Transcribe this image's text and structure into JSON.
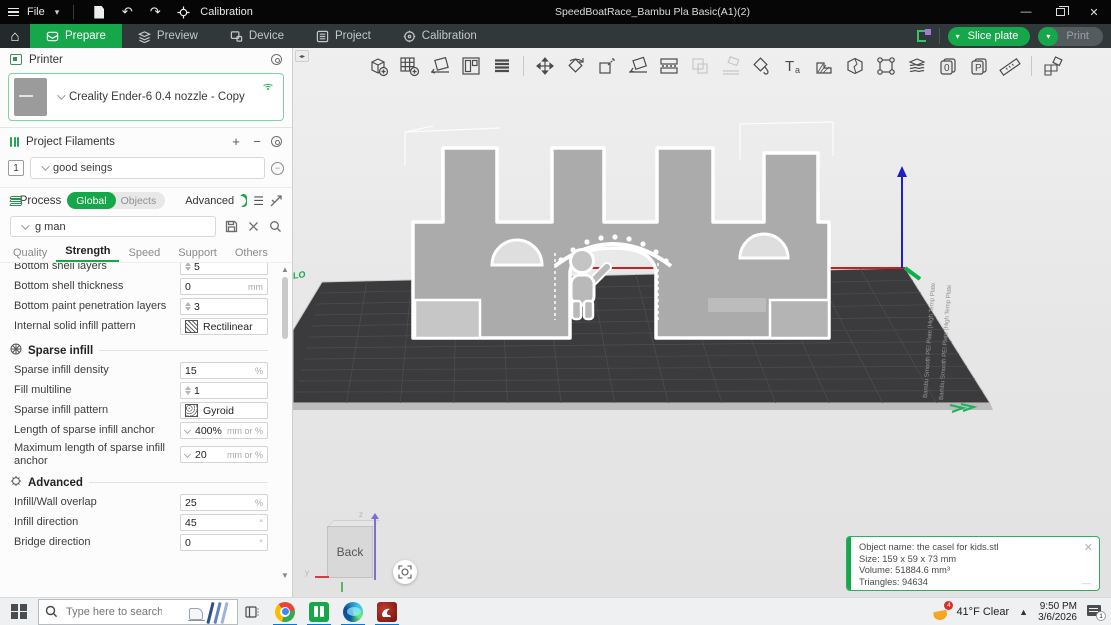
{
  "titlebar": {
    "file_label": "File",
    "calibration_label": "Calibration",
    "title": "SpeedBoatRace_Bambu Pla Basic(A1)(2)"
  },
  "ribbon": {
    "tabs": [
      {
        "label": "Prepare"
      },
      {
        "label": "Preview"
      },
      {
        "label": "Device"
      },
      {
        "label": "Project"
      },
      {
        "label": "Calibration"
      }
    ],
    "slice_label": "Slice plate",
    "print_label": "Print"
  },
  "sidebar": {
    "printer": {
      "header": "Printer",
      "name": "Creality Ender-6 0.4 nozzle - Copy"
    },
    "filaments": {
      "header": "Project Filaments",
      "index": "1",
      "name": "good seings"
    },
    "process": {
      "header": "Process",
      "global_label": "Global",
      "objects_label": "Objects",
      "advanced_label": "Advanced"
    },
    "search_value": "g man",
    "tabs": [
      {
        "label": "Quality"
      },
      {
        "label": "Strength"
      },
      {
        "label": "Speed"
      },
      {
        "label": "Support"
      },
      {
        "label": "Others"
      }
    ],
    "params": {
      "rows": [
        {
          "label": "Bottom shell layers",
          "value": "5",
          "unit": ""
        },
        {
          "label": "Bottom shell thickness",
          "value": "0",
          "unit": "mm"
        },
        {
          "label": "Bottom paint penetration layers",
          "value": "3",
          "unit": ""
        },
        {
          "label": "Internal solid infill pattern",
          "value": "Rectilinear",
          "unit": ""
        },
        {
          "label": "Sparse infill"
        },
        {
          "label": "Sparse infill density",
          "value": "15",
          "unit": "%"
        },
        {
          "label": "Fill multiline",
          "value": "1",
          "unit": ""
        },
        {
          "label": "Sparse infill pattern",
          "value": "Gyroid",
          "unit": ""
        },
        {
          "label": "Length of sparse infill anchor",
          "value": "400%",
          "unit": "mm or %"
        },
        {
          "label": "Maximum length of sparse infill anchor",
          "value": "20",
          "unit": "mm or %"
        },
        {
          "label": "Advanced"
        },
        {
          "label": "Infill/Wall overlap",
          "value": "25",
          "unit": "%"
        },
        {
          "label": "Infill direction",
          "value": "45",
          "unit": "°"
        },
        {
          "label": "Bridge direction",
          "value": "0",
          "unit": "°"
        }
      ]
    }
  },
  "viewport": {
    "toolbar_icons": [
      "add-object",
      "add-plate",
      "auto-orient",
      "arrange",
      "objects-list",
      "move",
      "rotate",
      "scale",
      "lay-on-face",
      "split-plate",
      "merge",
      "lay-flat",
      "paint",
      "text",
      "support-paint",
      "cut",
      "seam",
      "variable-layer-height",
      "document-zero",
      "document-p",
      "measure",
      "assembly"
    ],
    "plate_label_line1": "Bambu Smooth PEI Plate (High Temp Plate",
    "plate_label_line2": "Bambu Smooth PEI Plate (High Temp Plate",
    "corner_label": "LO",
    "nav_cube_label": "Back",
    "axis_z_label": "z",
    "axis_y_label": "y"
  },
  "info_box": {
    "object_name": "Object name: the casel for kids.stl",
    "size": "Size: 159 x 59 x 73 mm",
    "volume": "Volume: 51884.6 mm³",
    "triangles": "Triangles: 94634"
  },
  "taskbar": {
    "search_placeholder": "Type here to search",
    "weather": "41°F Clear",
    "weather_badge": "4",
    "time": "9:50 PM",
    "date": "3/6/2026",
    "notification_badge": "1"
  },
  "colors": {
    "accent_green": "#17a74b",
    "taskbar_active_blue": "#0078d7",
    "plate_dark": "#3b3b3d"
  }
}
